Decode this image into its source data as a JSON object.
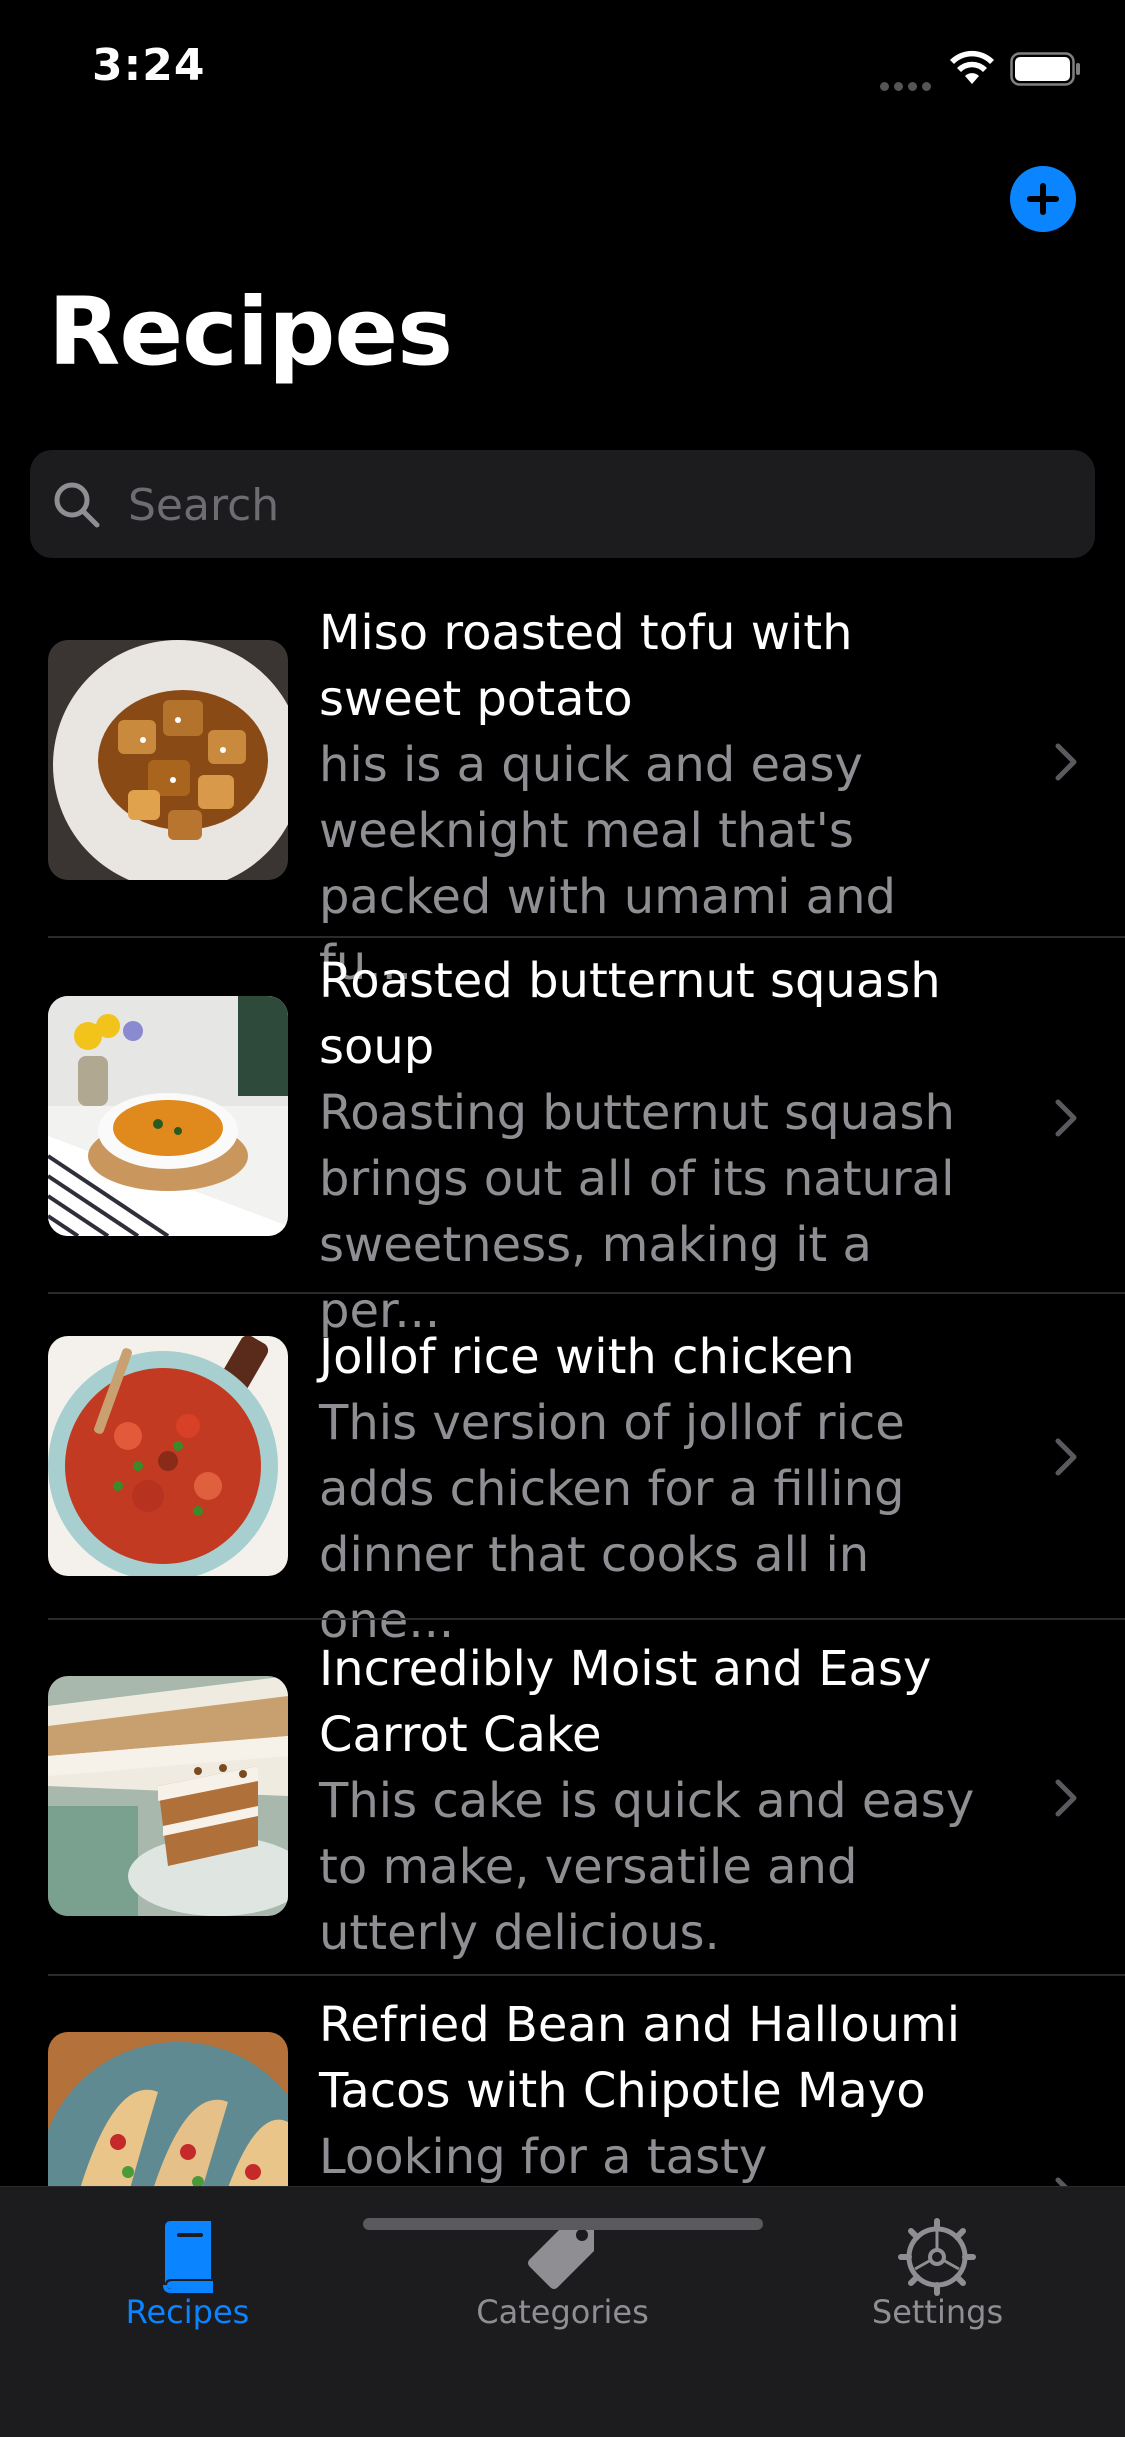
{
  "status": {
    "time": "3:24"
  },
  "header": {
    "title": "Recipes"
  },
  "search": {
    "placeholder": "Search"
  },
  "recipes": [
    {
      "title": "Miso roasted tofu with sweet potato",
      "description": "his is a quick and easy weeknight meal that's packed with umami and fu..."
    },
    {
      "title": "Roasted butternut squash soup",
      "description": "Roasting butternut squash brings out all of its natural sweetness, making it a per..."
    },
    {
      "title": "Jollof rice with chicken",
      "description": "This version of jollof rice adds chicken for a filling dinner that cooks all in one..."
    },
    {
      "title": "Incredibly Moist and Easy Carrot Cake",
      "description": "This cake is quick and easy to make, versatile and utterly delicious."
    },
    {
      "title": "Refried Bean and Halloumi Tacos with Chipotle Mayo",
      "description": "Looking for a tasty midweek"
    }
  ],
  "tabs": [
    {
      "label": "Recipes",
      "icon": "book-icon",
      "active": true
    },
    {
      "label": "Categories",
      "icon": "tag-icon",
      "active": false
    },
    {
      "label": "Settings",
      "icon": "gear-icon",
      "active": false
    }
  ],
  "colors": {
    "accent": "#0a84ff",
    "background": "#000000",
    "secondary_text": "#8e8e93",
    "tab_inactive": "#8e8e93"
  }
}
